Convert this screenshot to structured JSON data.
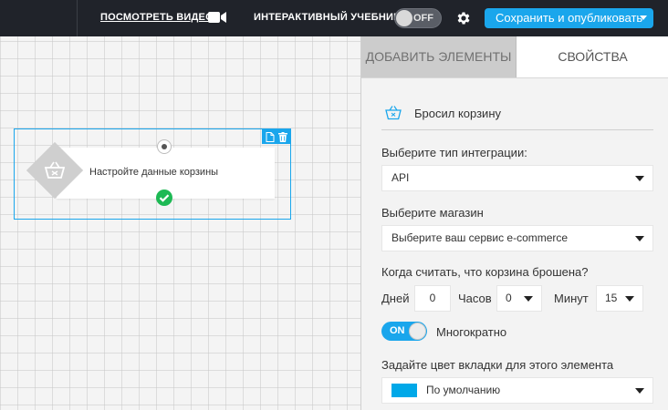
{
  "topbar": {
    "watch_video": "ПОСМОТРЕТЬ ВИДЕО",
    "tutorial_label": "ИНТЕРАКТИВНЫЙ УЧЕБНИК",
    "tutorial_toggle": "OFF",
    "publish_button": "Сохранить и опубликовать"
  },
  "canvas": {
    "node_label": "Настройте данные корзины"
  },
  "panel": {
    "tabs": [
      {
        "label": "ДОБАВИТЬ ЭЛЕМЕНТЫ",
        "active": true
      },
      {
        "label": "СВОЙСТВА",
        "active": false
      }
    ],
    "element_title": "Бросил корзину",
    "integration_label": "Выберите тип интеграции:",
    "integration_value": "API",
    "store_label": "Выберите магазин",
    "store_value": "Выберите ваш сервис e-commerce",
    "abandon_label": "Когда считать, что корзина брошена?",
    "days_label": "Дней",
    "days_value": "0",
    "hours_label": "Часов",
    "hours_value": "0",
    "minutes_label": "Минут",
    "minutes_value": "15",
    "repeat_toggle": "ON",
    "repeat_label": "Многократно",
    "color_label": "Задайте цвет вкладки для этого элемента",
    "color_value": "По умолчанию"
  },
  "colors": {
    "accent": "#1aa6ec",
    "topbar_bg": "#20232a",
    "swatch": "#00a8e8",
    "success": "#1db954"
  },
  "icons": [
    "camera-icon",
    "gear-icon",
    "file-icon",
    "trash-icon",
    "basket-icon",
    "check-icon",
    "chevron-down-icon"
  ]
}
